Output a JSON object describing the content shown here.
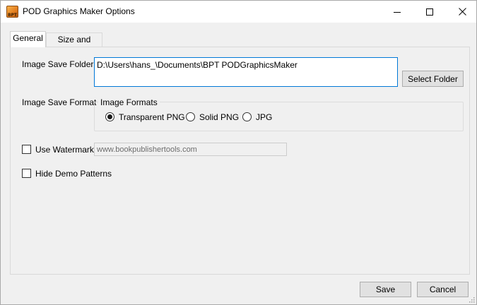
{
  "window": {
    "title": "POD Graphics Maker Options",
    "icon_text": "BPT"
  },
  "tabs": [
    {
      "label": "General",
      "active": true
    },
    {
      "label": "Size and Tiling",
      "active": false
    }
  ],
  "general": {
    "image_save_folder_label": "Image Save Folder:",
    "image_save_folder_value": "D:\\Users\\hans_\\Documents\\BPT PODGraphicsMaker",
    "select_folder_label": "Select Folder",
    "image_save_format_label": "Image Save Format",
    "image_formats_group_label": "Image Formats",
    "formats": [
      {
        "label": "Transparent PNG",
        "checked": true
      },
      {
        "label": "Solid PNG",
        "checked": false
      },
      {
        "label": "JPG",
        "checked": false
      }
    ],
    "use_watermark_label": "Use Watermark",
    "use_watermark_checked": false,
    "watermark_value": "www.bookpublishertools.com",
    "hide_demo_patterns_label": "Hide Demo Patterns",
    "hide_demo_patterns_checked": false
  },
  "footer": {
    "save_label": "Save",
    "cancel_label": "Cancel"
  },
  "colors": {
    "focus_border": "#0078d7",
    "dialog_bg": "#f0f0f0"
  }
}
